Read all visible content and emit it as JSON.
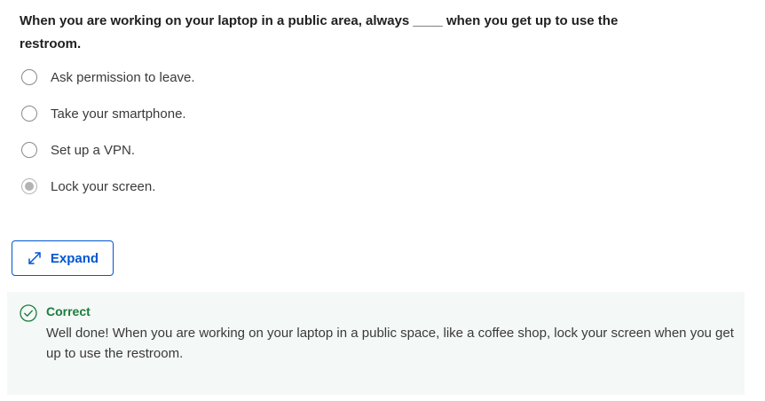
{
  "question": {
    "text": "When you are working on your laptop in a public area, always ____ when you get up to use the restroom."
  },
  "options": [
    {
      "label": "Ask permission to leave.",
      "selected": false
    },
    {
      "label": "Take your smartphone.",
      "selected": false
    },
    {
      "label": "Set up a VPN.",
      "selected": false
    },
    {
      "label": "Lock your screen.",
      "selected": true
    }
  ],
  "expand_button": {
    "label": "Expand",
    "icon": "expand-arrows-icon"
  },
  "feedback": {
    "status": "Correct",
    "icon": "check-circle-icon",
    "message": "Well done! When you are working on your laptop in a public space, like a coffee shop, lock your screen when you get up to use the restroom."
  },
  "colors": {
    "accent": "#0056d2",
    "correct": "#1b7d3e",
    "feedback_bg": "#f4f8f6"
  }
}
